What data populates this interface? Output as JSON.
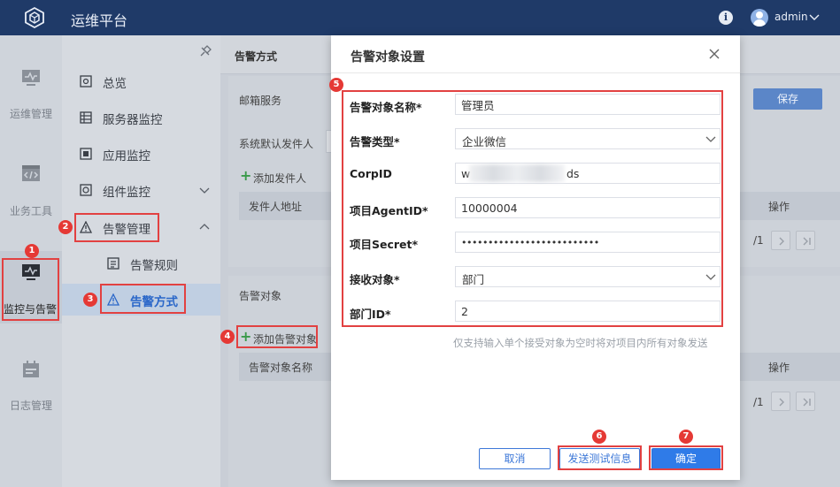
{
  "topbar": {
    "app_title": "运维平台",
    "user_name": "admin",
    "info_icon": "i"
  },
  "rail": [
    {
      "label": "运维管理",
      "icon": "monitor-icon"
    },
    {
      "label": "业务工具",
      "icon": "code-icon"
    },
    {
      "label": "监控与告警",
      "icon": "pulse-icon"
    },
    {
      "label": "日志管理",
      "icon": "calendar-icon"
    }
  ],
  "sidebar": {
    "items": [
      {
        "label": "总览"
      },
      {
        "label": "服务器监控"
      },
      {
        "label": "应用监控"
      },
      {
        "label": "组件监控"
      },
      {
        "label": "告警管理"
      },
      {
        "label": "告警规则"
      },
      {
        "label": "告警方式"
      }
    ]
  },
  "main": {
    "header_title": "告警方式",
    "mail_section": "邮箱服务",
    "save_label": "保存",
    "default_sender": "系统默认发件人",
    "add_sender": "添加发件人",
    "sender_col": "发件人地址",
    "ops_col": "操作",
    "pager_total": "/1",
    "target_section": "告警对象",
    "add_target": "添加告警对象",
    "target_col": "告警对象名称",
    "ops_col2": "操作",
    "pager_total2": "/1"
  },
  "modal": {
    "title": "告警对象设置",
    "fields": {
      "name": {
        "label": "告警对象名称*",
        "value": "管理员"
      },
      "type": {
        "label": "告警类型*",
        "value": "企业微信"
      },
      "corpid": {
        "label": "CorpID",
        "prefix": "w",
        "suffix": "ds"
      },
      "agentid": {
        "label": "项目AgentID*",
        "value": "10000004"
      },
      "secret": {
        "label": "项目Secret*",
        "value": "••••••••••••••••••••••••••"
      },
      "receiver": {
        "label": "接收对象*",
        "value": "部门"
      },
      "deptid": {
        "label": "部门ID*",
        "value": "2"
      }
    },
    "hint": "仅支持输入单个接受对象为空时将对项目内所有对象发送",
    "cancel_label": "取消",
    "test_label": "发送测试信息",
    "ok_label": "确定"
  },
  "badges": [
    "1",
    "2",
    "3",
    "4",
    "5",
    "6",
    "7"
  ],
  "colors": {
    "topbar": "#1f3a68",
    "primary": "#2f7be8",
    "annotation": "#e24141",
    "add_green": "#3a9a4a"
  }
}
